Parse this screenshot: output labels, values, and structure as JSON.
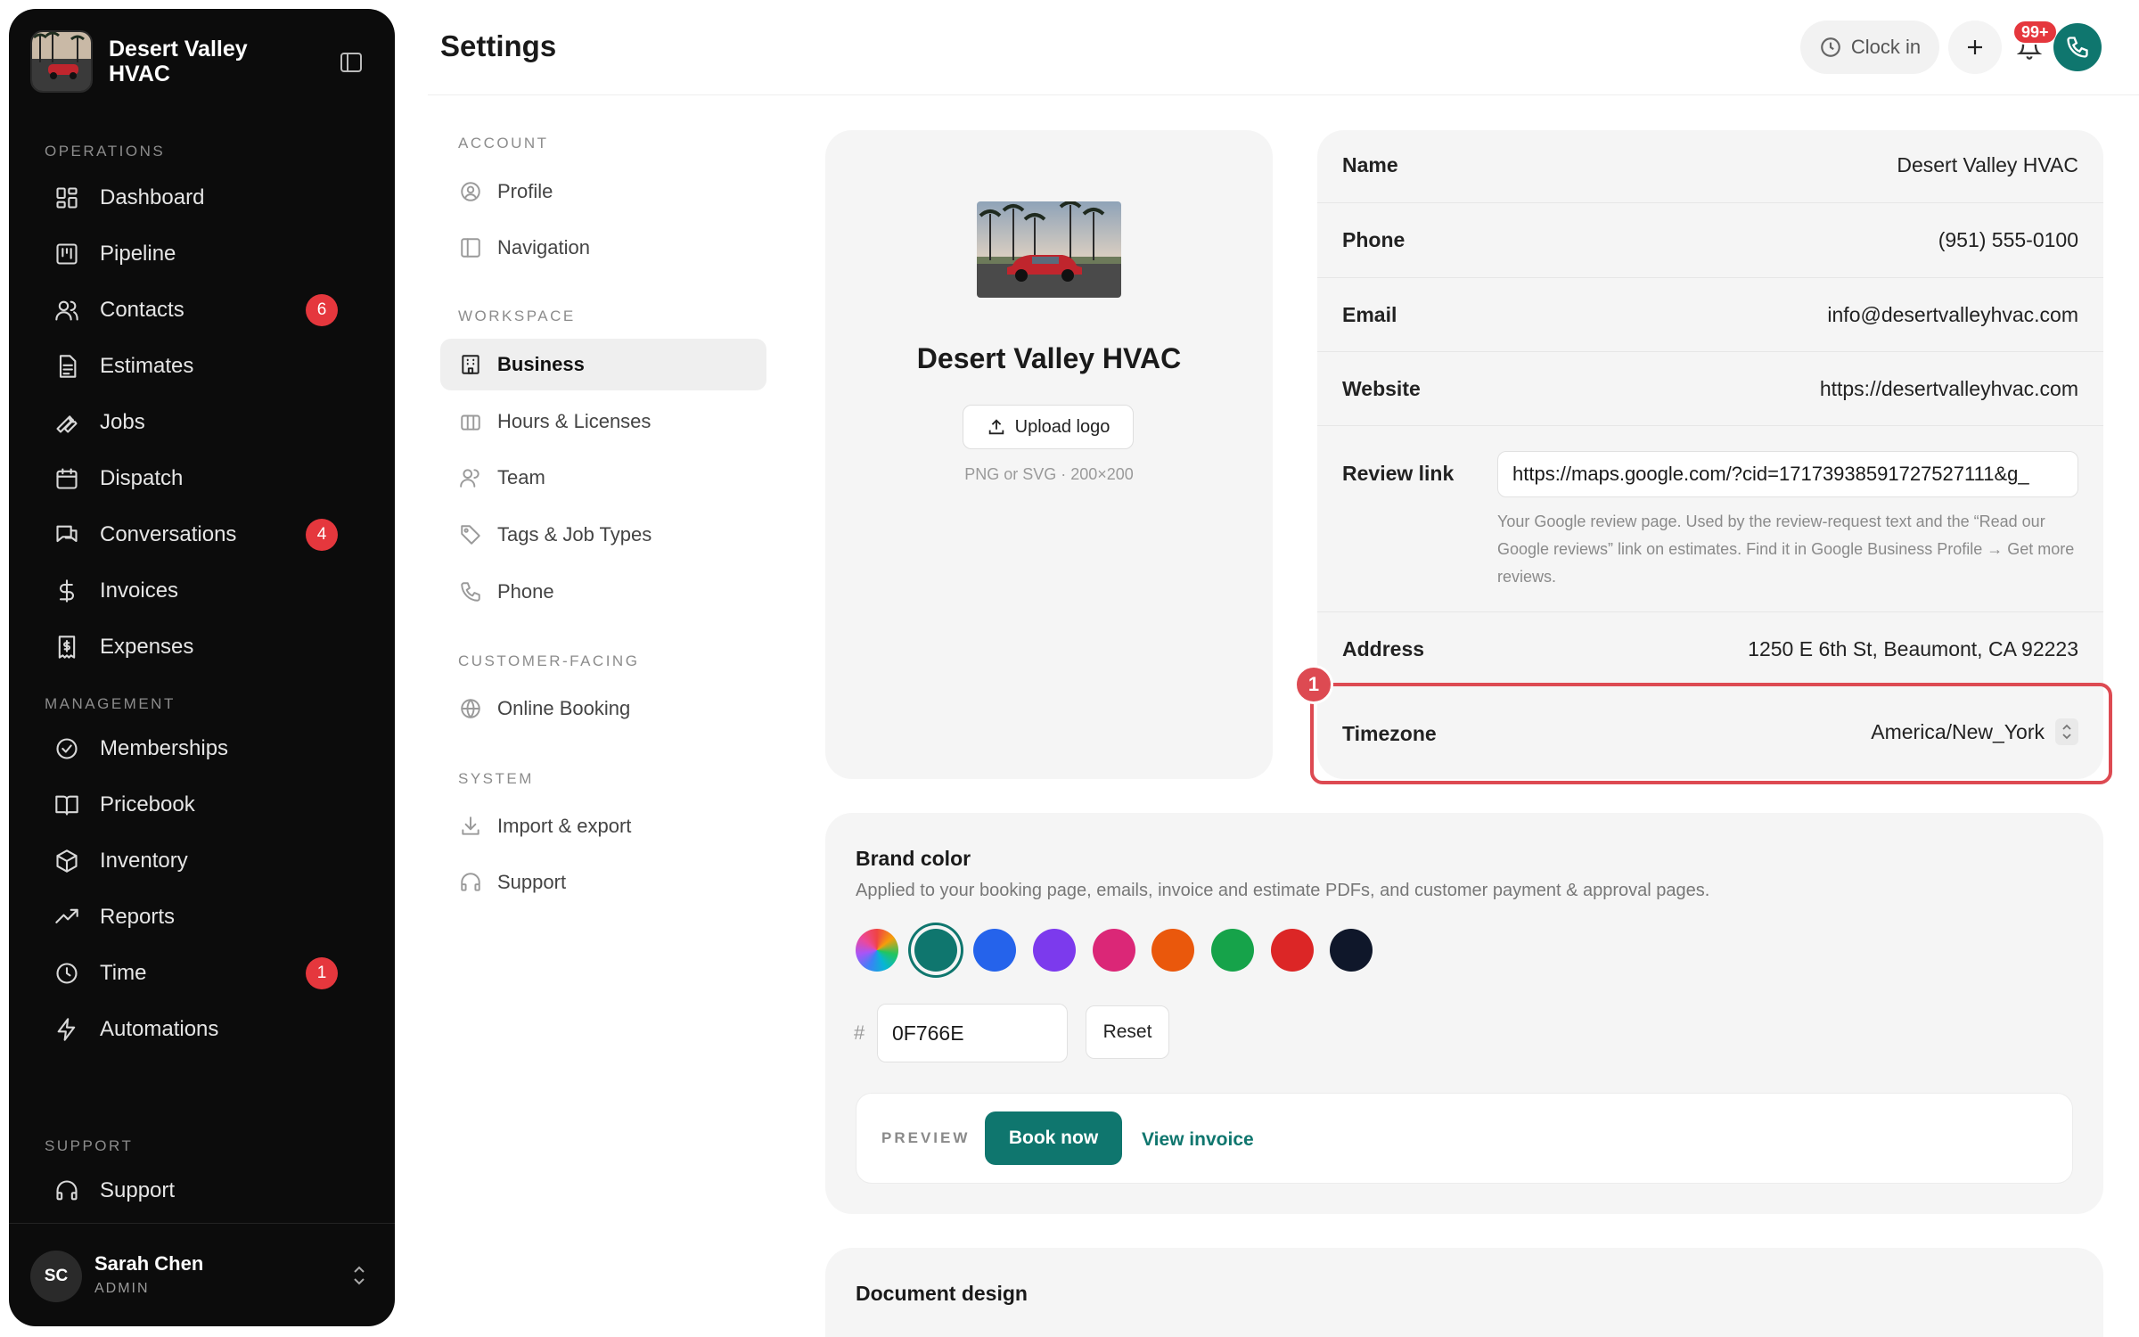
{
  "sidebar": {
    "brand_name": "Desert Valley HVAC",
    "sections": {
      "operations": "OPERATIONS",
      "management": "MANAGEMENT",
      "support": "SUPPORT"
    },
    "items": [
      {
        "label": "Dashboard",
        "icon": "dashboard-icon"
      },
      {
        "label": "Pipeline",
        "icon": "pipeline-icon"
      },
      {
        "label": "Contacts",
        "icon": "contacts-icon",
        "badge": "6"
      },
      {
        "label": "Estimates",
        "icon": "estimates-icon"
      },
      {
        "label": "Jobs",
        "icon": "wrench-icon"
      },
      {
        "label": "Dispatch",
        "icon": "calendar-icon"
      },
      {
        "label": "Conversations",
        "icon": "chat-icon",
        "badge": "4"
      },
      {
        "label": "Invoices",
        "icon": "dollar-icon"
      },
      {
        "label": "Expenses",
        "icon": "receipt-icon"
      },
      {
        "label": "Memberships",
        "icon": "badge-check-icon"
      },
      {
        "label": "Pricebook",
        "icon": "book-icon"
      },
      {
        "label": "Inventory",
        "icon": "box-icon"
      },
      {
        "label": "Reports",
        "icon": "trend-icon"
      },
      {
        "label": "Time",
        "icon": "clock-icon",
        "badge": "1"
      },
      {
        "label": "Automations",
        "icon": "bolt-icon"
      },
      {
        "label": "Support",
        "icon": "headset-icon"
      }
    ],
    "user": {
      "initials": "SC",
      "name": "Sarah Chen",
      "role": "ADMIN"
    }
  },
  "header": {
    "title": "Settings",
    "clock_in": "Clock in",
    "notifications_badge": "99+"
  },
  "settings_nav": {
    "sections": {
      "account": "ACCOUNT",
      "workspace": "WORKSPACE",
      "customer": "CUSTOMER-FACING",
      "system": "SYSTEM"
    },
    "items": [
      {
        "label": "Profile",
        "icon": "user-circle-icon"
      },
      {
        "label": "Navigation",
        "icon": "sidebar-layout-icon"
      },
      {
        "label": "Business",
        "icon": "building-icon",
        "active": true
      },
      {
        "label": "Hours & Licenses",
        "icon": "hours-icon"
      },
      {
        "label": "Team",
        "icon": "team-icon"
      },
      {
        "label": "Tags & Job Types",
        "icon": "tag-icon"
      },
      {
        "label": "Phone",
        "icon": "phone-icon"
      },
      {
        "label": "Online Booking",
        "icon": "globe-icon"
      },
      {
        "label": "Import & export",
        "icon": "download-icon"
      },
      {
        "label": "Support",
        "icon": "headset-icon"
      }
    ]
  },
  "logo_card": {
    "business_name": "Desert Valley HVAC",
    "upload_label": "Upload logo",
    "hint": "PNG or SVG · 200×200"
  },
  "details": {
    "name": {
      "label": "Name",
      "value": "Desert Valley HVAC"
    },
    "phone": {
      "label": "Phone",
      "value": "(951) 555-0100"
    },
    "email": {
      "label": "Email",
      "value": "info@desertvalleyhvac.com"
    },
    "website": {
      "label": "Website",
      "value": "https://desertvalleyhvac.com"
    },
    "review": {
      "label": "Review link",
      "value": "https://maps.google.com/?cid=17173938591727527111&g_",
      "help": "Your Google review page. Used by the review-request text and the “Read our Google reviews” link on estimates. Find it in Google Business Profile → Get more reviews."
    },
    "address": {
      "label": "Address",
      "value": "1250 E 6th St, Beaumont, CA 92223"
    },
    "timezone": {
      "label": "Timezone",
      "value": "America/New_York",
      "marker": "1"
    }
  },
  "brand_color": {
    "title": "Brand color",
    "description": "Applied to your booking page, emails, invoice and estimate PDFs, and customer payment & approval pages.",
    "swatches": [
      "rainbow",
      "#0f766e",
      "#2563eb",
      "#7c3aed",
      "#db2777",
      "#ea580c",
      "#16a34a",
      "#dc2626",
      "#0f172a"
    ],
    "selected": "#0f766e",
    "hash": "#",
    "hex_value": "0F766E",
    "reset_label": "Reset",
    "preview_label": "PREVIEW",
    "book_now": "Book now",
    "view_invoice": "View invoice"
  },
  "document_design": {
    "title": "Document design"
  },
  "colors": {
    "accent": "#0f766e",
    "badge": "#e5373d",
    "highlight": "#dd4a52"
  }
}
